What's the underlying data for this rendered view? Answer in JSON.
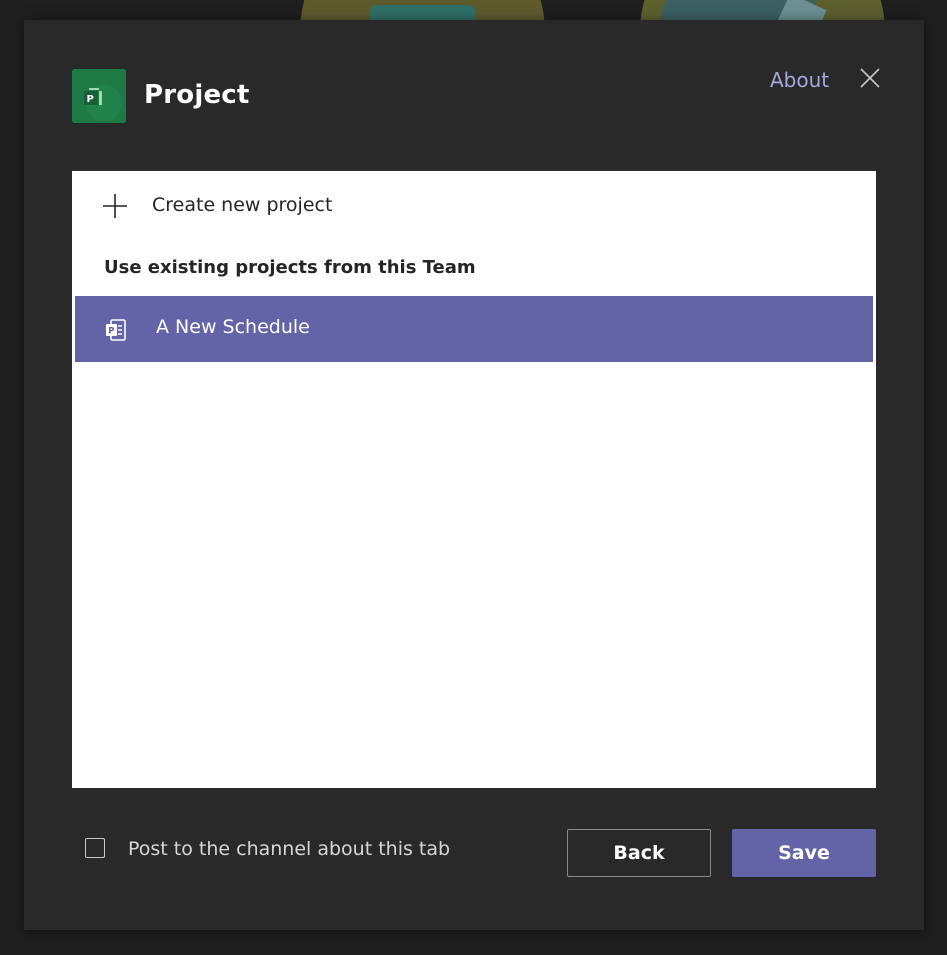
{
  "dialog": {
    "title": "Project",
    "about_label": "About",
    "app_icon_letter": "P"
  },
  "panel": {
    "create_label": "Create new project",
    "section_heading": "Use existing projects from this Team",
    "projects": [
      {
        "label": "A New Schedule",
        "selected": true
      }
    ]
  },
  "footer": {
    "checkbox_label": "Post to the channel about this tab",
    "checkbox_checked": false,
    "back_label": "Back",
    "save_label": "Save"
  },
  "colors": {
    "accent": "#6264a7",
    "about_link": "#a6a7dc",
    "dialog_bg": "#292929",
    "app_icon_bg": "#1e7a45"
  }
}
